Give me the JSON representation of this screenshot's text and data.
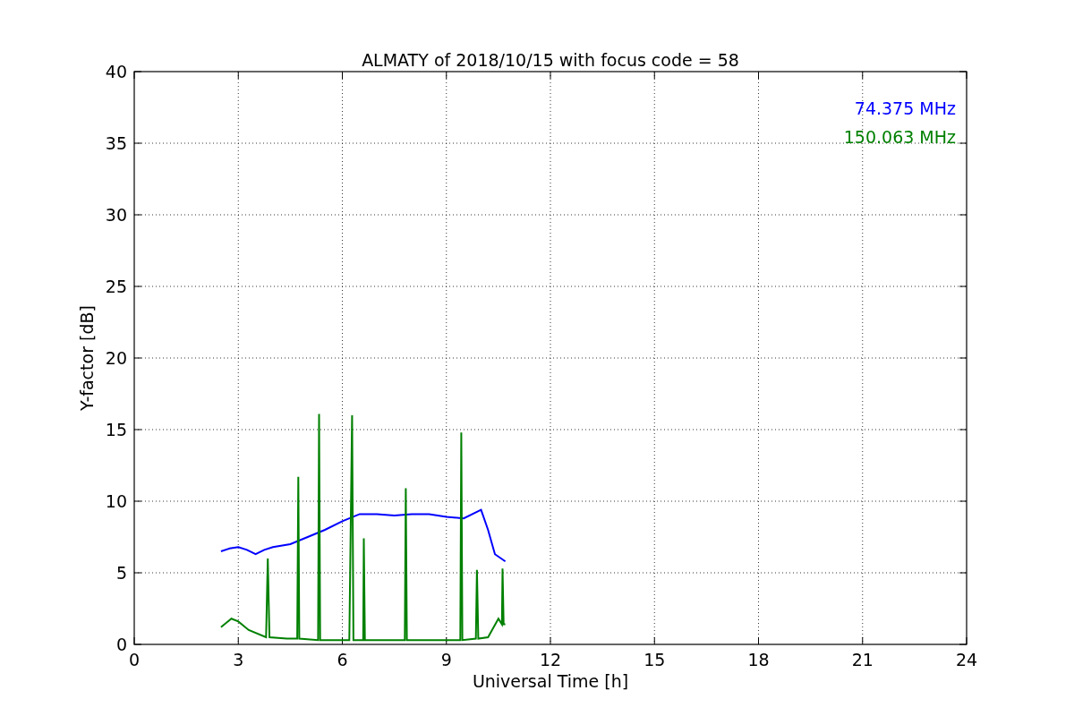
{
  "figure": {
    "chart_data": {
      "type": "line",
      "grid": true,
      "title": "ALMATY of 2018/10/15 with focus code = 58",
      "xlabel": "Universal Time [h]",
      "ylabel": "Y-factor [dB]",
      "xlim": [
        0,
        24
      ],
      "ylim": [
        0,
        40
      ],
      "xticks": [
        0,
        3,
        6,
        9,
        12,
        15,
        18,
        21,
        24
      ],
      "yticks": [
        0,
        5,
        10,
        15,
        20,
        25,
        30,
        35,
        40
      ],
      "series": [
        {
          "name": "74.375 MHz",
          "color": "#0000ff",
          "x": [
            2.5,
            2.75,
            3,
            3.25,
            3.5,
            3.75,
            4,
            4.5,
            5,
            5.5,
            6,
            6.5,
            7,
            7.5,
            8,
            8.5,
            9,
            9.5,
            10,
            10.2,
            10.4,
            10.7
          ],
          "values": [
            6.5,
            6.7,
            6.8,
            6.6,
            6.3,
            6.6,
            6.8,
            7.0,
            7.5,
            8.0,
            8.6,
            9.1,
            9.1,
            9.0,
            9.1,
            9.1,
            8.9,
            8.8,
            9.4,
            8.0,
            6.3,
            5.8
          ]
        },
        {
          "name": "150.063 MHz",
          "color": "#008000",
          "x": [
            2.5,
            2.8,
            3,
            3.3,
            3.8,
            3.85,
            3.9,
            4.4,
            4.7,
            4.73,
            4.76,
            5.3,
            5.33,
            5.36,
            6.2,
            6.28,
            6.32,
            6.6,
            6.62,
            6.65,
            7.8,
            7.83,
            7.86,
            9.4,
            9.43,
            9.46,
            9.85,
            9.88,
            9.92,
            10.2,
            10.5,
            10.6,
            10.62,
            10.65,
            10.7
          ],
          "values": [
            1.2,
            1.8,
            1.6,
            1.0,
            0.5,
            6.0,
            0.5,
            0.4,
            0.4,
            11.7,
            0.4,
            0.3,
            16.1,
            0.3,
            0.3,
            16.0,
            0.3,
            0.3,
            7.4,
            0.3,
            0.3,
            10.9,
            0.3,
            0.3,
            14.8,
            0.3,
            0.4,
            5.2,
            0.4,
            0.5,
            1.8,
            1.4,
            5.3,
            1.4,
            1.4
          ]
        }
      ]
    }
  }
}
